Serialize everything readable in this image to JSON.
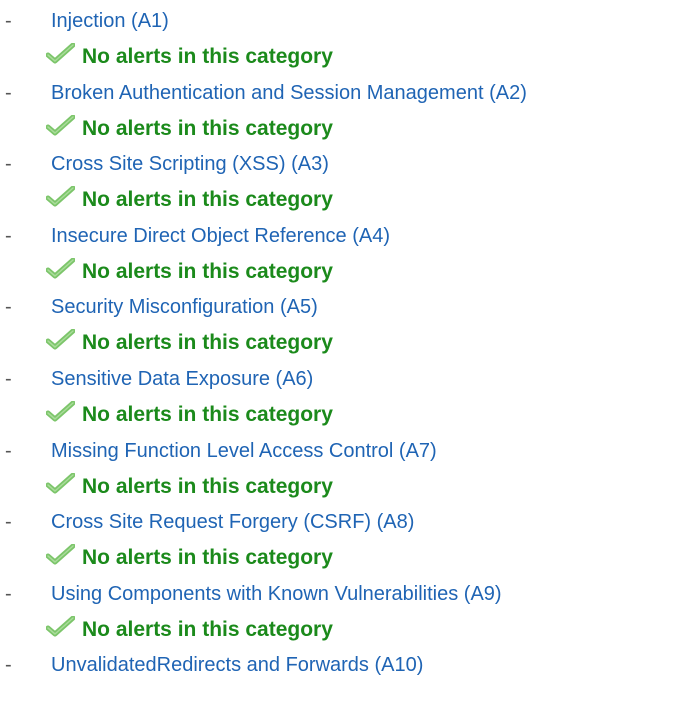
{
  "colors": {
    "link": "#1f64b4",
    "ok_text": "#1b8a1b",
    "check_icon": "#7cc56a"
  },
  "categories": [
    {
      "label": "Injection (A1)",
      "status": "No alerts in this category",
      "icon": "check-icon"
    },
    {
      "label": "Broken Authentication and Session Management (A2)",
      "status": "No alerts in this category",
      "icon": "check-icon"
    },
    {
      "label": "Cross Site Scripting (XSS) (A3)",
      "status": "No alerts in this category",
      "icon": "check-icon"
    },
    {
      "label": "Insecure Direct Object Reference (A4)",
      "status": "No alerts in this category",
      "icon": "check-icon"
    },
    {
      "label": "Security Misconfiguration (A5)",
      "status": "No alerts in this category",
      "icon": "check-icon"
    },
    {
      "label": "Sensitive Data Exposure (A6)",
      "status": "No alerts in this category",
      "icon": "check-icon"
    },
    {
      "label": "Missing Function Level Access Control (A7)",
      "status": "No alerts in this category",
      "icon": "check-icon"
    },
    {
      "label": "Cross Site Request Forgery (CSRF) (A8)",
      "status": "No alerts in this category",
      "icon": "check-icon"
    },
    {
      "label": "Using Components with Known Vulnerabilities (A9)",
      "status": "No alerts in this category",
      "icon": "check-icon"
    },
    {
      "label": "UnvalidatedRedirects and Forwards (A10)",
      "status": "",
      "icon": ""
    }
  ]
}
